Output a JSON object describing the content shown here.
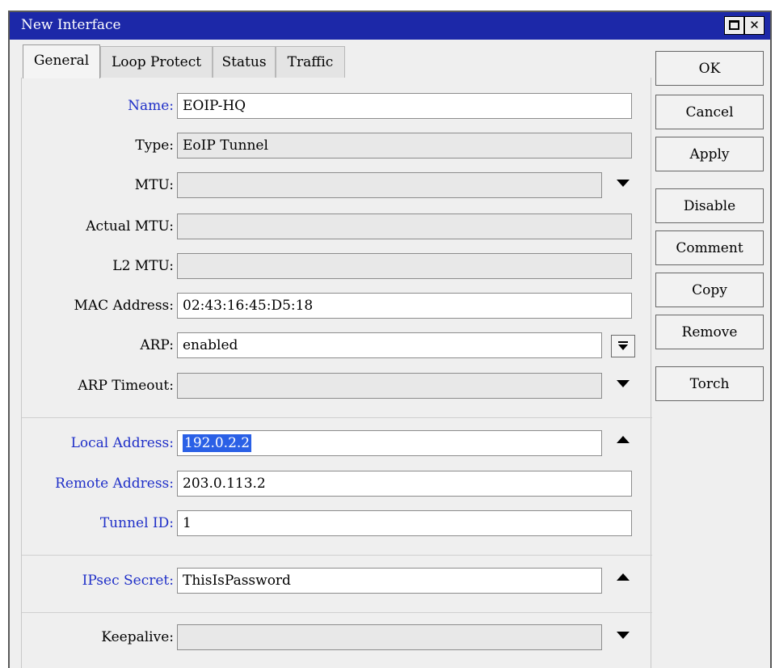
{
  "window": {
    "title": "New Interface"
  },
  "tabs": [
    {
      "label": "General",
      "active": true
    },
    {
      "label": "Loop Protect",
      "active": false
    },
    {
      "label": "Status",
      "active": false
    },
    {
      "label": "Traffic",
      "active": false
    }
  ],
  "fields": {
    "name": {
      "label": "Name:",
      "value": "EOIP-HQ"
    },
    "type": {
      "label": "Type:",
      "value": "EoIP Tunnel"
    },
    "mtu": {
      "label": "MTU:",
      "value": ""
    },
    "actual_mtu": {
      "label": "Actual MTU:",
      "value": ""
    },
    "l2_mtu": {
      "label": "L2 MTU:",
      "value": ""
    },
    "mac_address": {
      "label": "MAC Address:",
      "value": "02:43:16:45:D5:18"
    },
    "arp": {
      "label": "ARP:",
      "value": "enabled"
    },
    "arp_timeout": {
      "label": "ARP Timeout:",
      "value": ""
    },
    "local_address": {
      "label": "Local Address:",
      "value": "192.0.2.2"
    },
    "remote_address": {
      "label": "Remote Address:",
      "value": "203.0.113.2"
    },
    "tunnel_id": {
      "label": "Tunnel ID:",
      "value": "1"
    },
    "ipsec_secret": {
      "label": "IPsec Secret:",
      "value": "ThisIsPassword"
    },
    "keepalive": {
      "label": "Keepalive:",
      "value": ""
    }
  },
  "buttons": {
    "ok": "OK",
    "cancel": "Cancel",
    "apply": "Apply",
    "disable": "Disable",
    "comment": "Comment",
    "copy": "Copy",
    "remove": "Remove",
    "torch": "Torch"
  },
  "colors": {
    "titlebar": "#1c28a8",
    "required_label": "#1f2fc8",
    "selection": "#2a60e6"
  }
}
